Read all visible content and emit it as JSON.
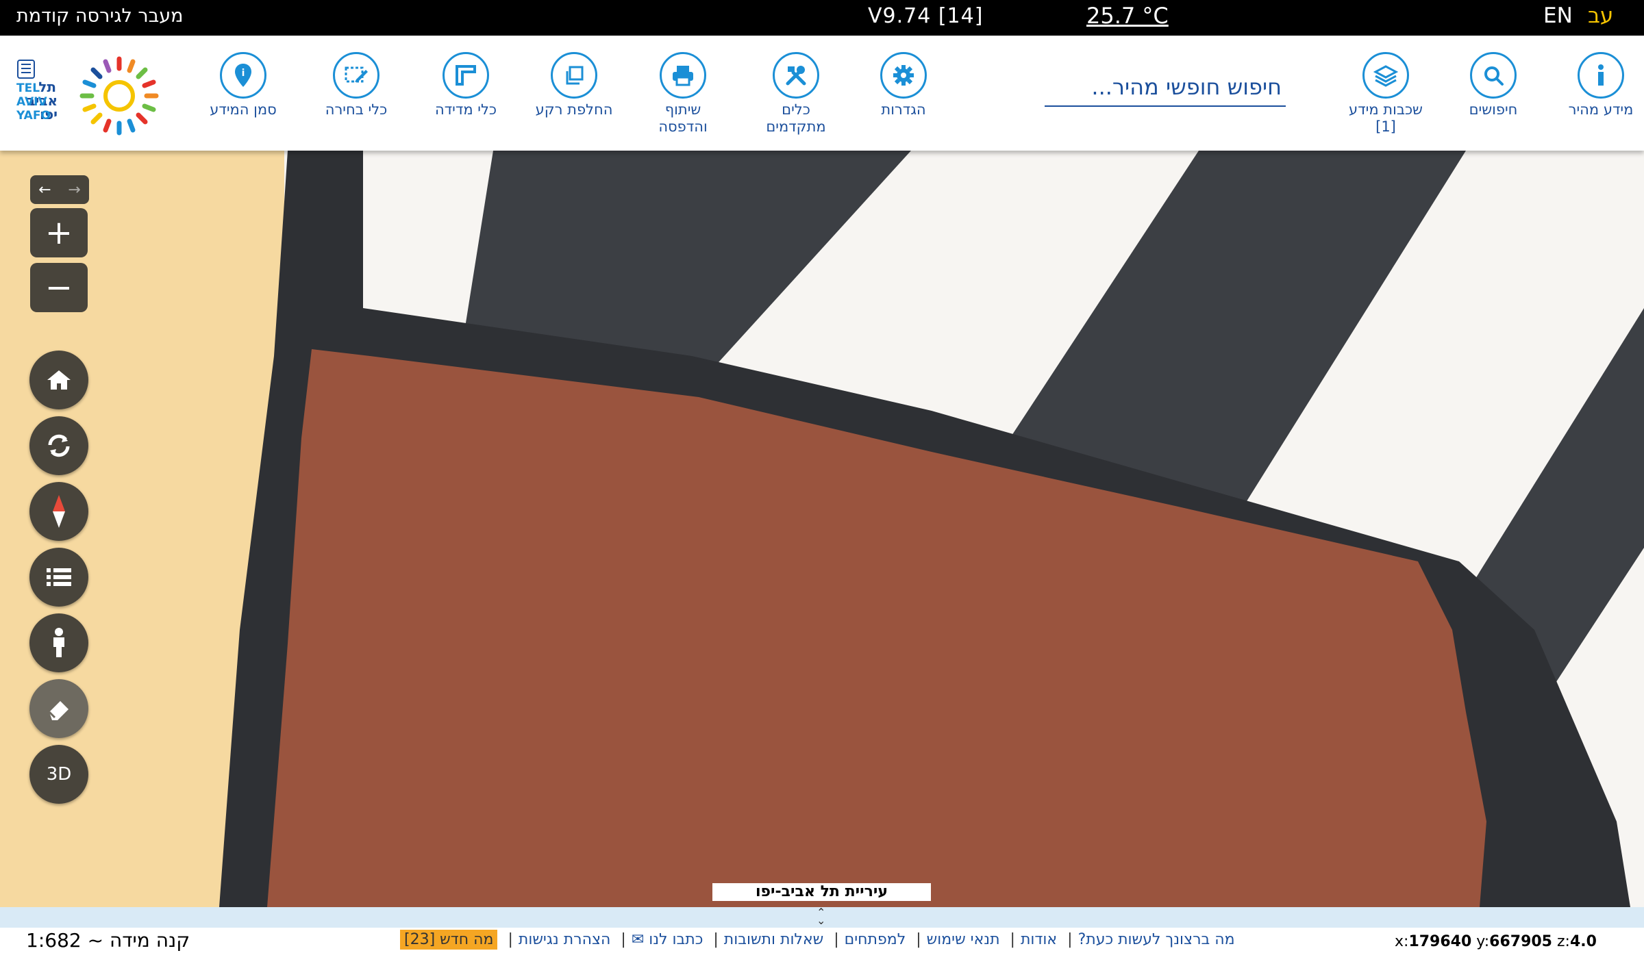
{
  "topbar": {
    "prev_version": "מעבר לגירסה קודמת",
    "version": "V9.74 [14]",
    "temperature": "25.7 °C",
    "lang_en": "EN",
    "lang_he": "עב"
  },
  "toolbar": {
    "quick_info": "מידע מהיר",
    "searches": "חיפושים",
    "info_layers": "שכבות מידע",
    "info_layers_count": "[1]",
    "search_placeholder": "חיפוש חופשי מהיר...",
    "settings": "הגדרות",
    "advanced_tools_1": "כלים",
    "advanced_tools_2": "מתקדמים",
    "share_print_1": "שיתוף",
    "share_print_2": "והדפסה",
    "switch_background": "החלפת רקע",
    "measure_tools": "כלי מדידה",
    "select_tools": "כלי בחירה",
    "mark_info": "סמן המידע"
  },
  "logo": {
    "he_1": "תל",
    "he_2": "אביב",
    "he_3": "יפו",
    "en_1": "TEL",
    "en_2": "AVIV",
    "en_3": "YAFO"
  },
  "map_controls": {
    "zoom_in": "+",
    "zoom_out": "−",
    "btn_3d": "3D"
  },
  "map": {
    "attribution": "עיריית תל אביב-יפו"
  },
  "footer": {
    "scale": "קנה מידה ~ 1:682",
    "links": [
      "מה ברצונך לעשות כעת?",
      "אודות",
      "תנאי שימוש",
      "למפתחים",
      "שאלות ותשובות",
      "כתבו לנו ✉",
      "הצהרת נגישות"
    ],
    "whats_new": "מה חדש [23]",
    "coord_x_label": "x:",
    "coord_x": "179640",
    "coord_y_label": "y:",
    "coord_y": "667905",
    "coord_z_label": "z:",
    "coord_z": "4.0"
  },
  "colors": {
    "topbar_bg": "#000000",
    "accent_blue": "#1b8fd6",
    "text_blue": "#1b4f9c",
    "lang_active": "#f5c400",
    "map_building": "#9a543e",
    "map_sand": "#f6d9a0",
    "map_road": "#3c3f44",
    "control_bg": "#48443b",
    "whats_new_bg": "#f5a623"
  },
  "icons": [
    "info-icon",
    "search-icon",
    "layers-icon",
    "gear-icon",
    "tools-icon",
    "printer-icon",
    "copy-icon",
    "ruler-icon",
    "select-icon",
    "marker-icon",
    "home-icon",
    "refresh-icon",
    "compass-icon",
    "list-icon",
    "person-icon",
    "eraser-icon"
  ]
}
